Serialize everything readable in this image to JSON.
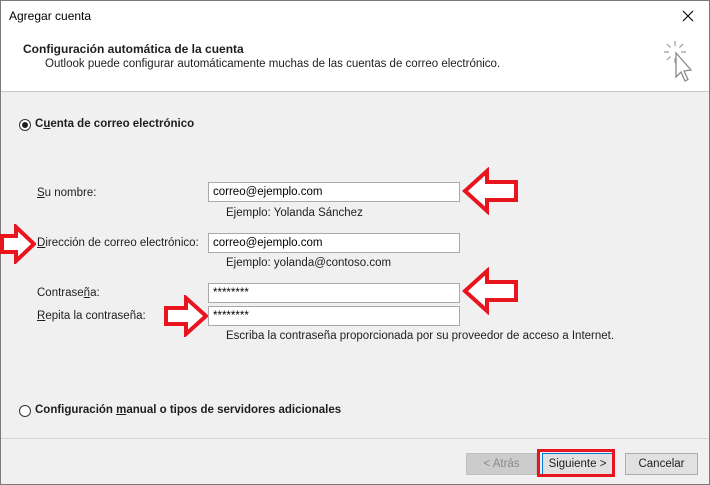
{
  "window": {
    "title": "Agregar cuenta"
  },
  "header": {
    "title": "Configuración automática de la cuenta",
    "subtitle": "Outlook puede configurar automáticamente muchas de las cuentas de correo electrónico."
  },
  "options": {
    "email_account": {
      "label": "Cuenta de correo electrónico",
      "selected": true
    },
    "manual_config": {
      "label": "Configuración manual o tipos de servidores adicionales",
      "selected": false
    }
  },
  "form": {
    "name": {
      "label": "Su nombre:",
      "value": "correo@ejemplo.com",
      "hint": "Ejemplo: Yolanda Sánchez"
    },
    "email": {
      "label": "Dirección de correo electrónico:",
      "value": "correo@ejemplo.com",
      "hint": "Ejemplo: yolanda@contoso.com"
    },
    "password": {
      "label": "Contraseña:",
      "value": "********"
    },
    "repeat_password": {
      "label": "Repita la contraseña:",
      "value": "********",
      "hint": "Escriba la contraseña proporcionada por su proveedor de acceso a Internet."
    }
  },
  "footer": {
    "back_label": "< Atrás",
    "next_label": "Siguiente >",
    "cancel_label": "Cancelar"
  },
  "colors": {
    "annotation": "#e8141e",
    "dialog_bg": "#f0f0f0",
    "focus": "#0078d7"
  },
  "icons": {
    "close": "close-icon",
    "wizard": "wizard-cursor-icon",
    "annotation_arrow": "red-arrow-icon"
  }
}
